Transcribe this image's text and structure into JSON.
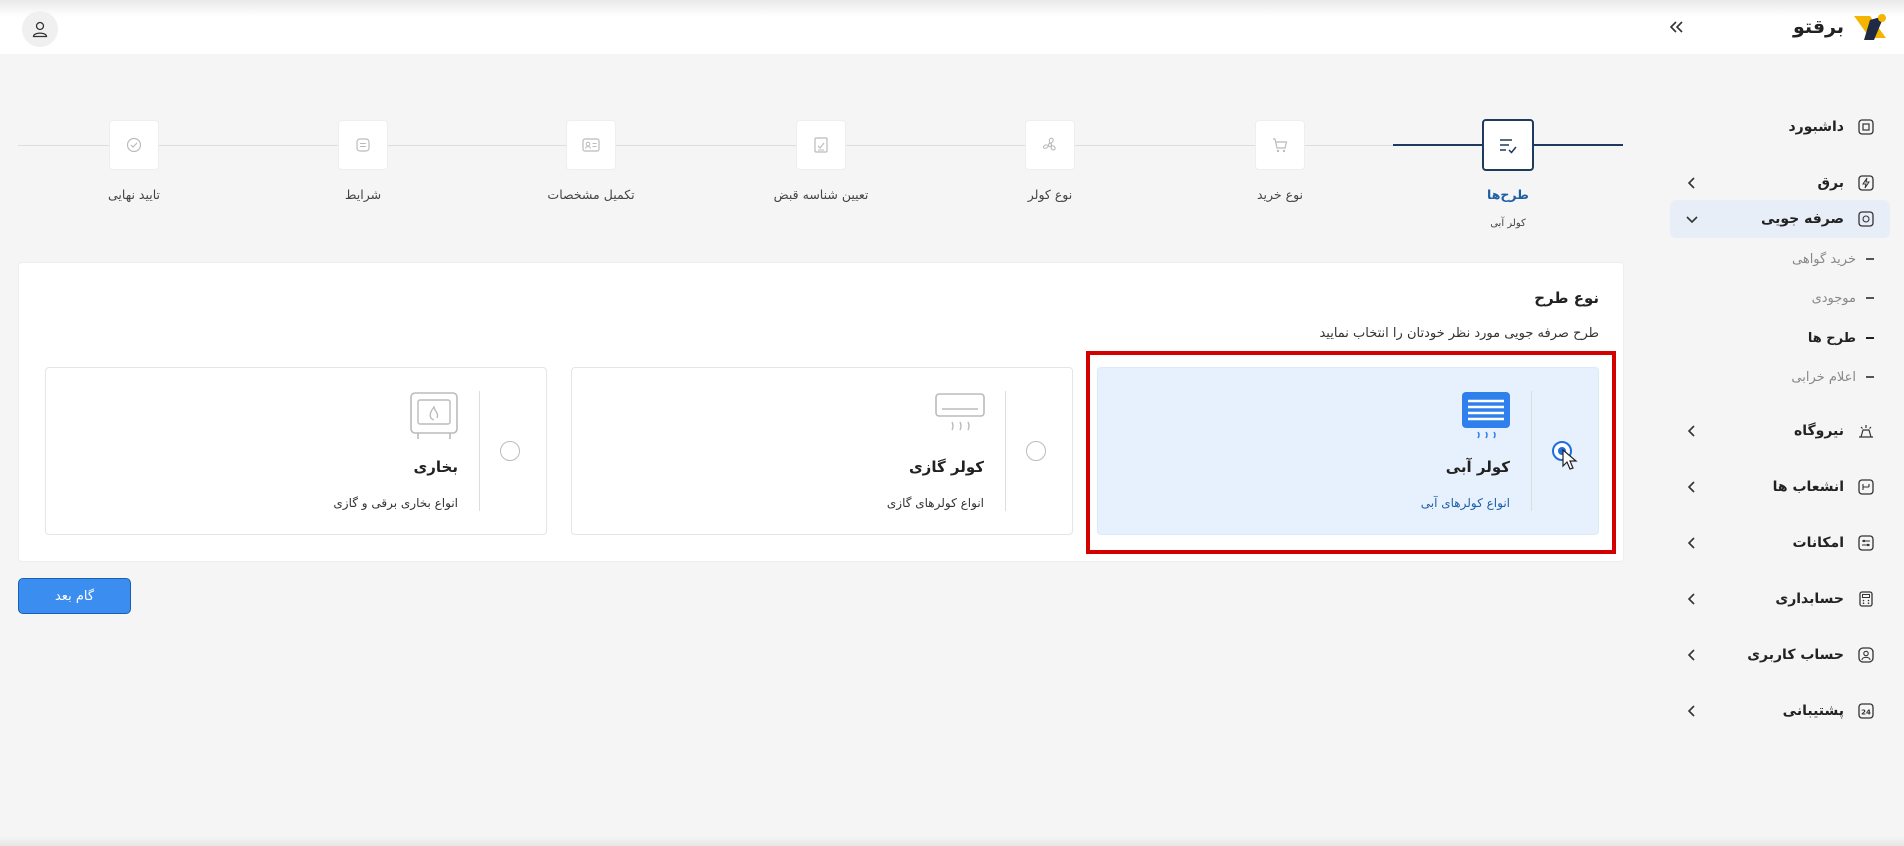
{
  "app": {
    "logo_text": "برقتو"
  },
  "sidebar": {
    "items": [
      {
        "label": "داشبورد",
        "icon": "dashboard-icon",
        "has_chevron": false
      },
      {
        "label": "برق",
        "icon": "electricity-icon",
        "has_chevron": true
      },
      {
        "label": "صرفه جویی",
        "icon": "saving-icon",
        "has_chevron": true,
        "expanded": true
      },
      {
        "label": "نیروگاه",
        "icon": "power-plant-icon",
        "has_chevron": true
      },
      {
        "label": "انشعاب ها",
        "icon": "branch-icon",
        "has_chevron": true
      },
      {
        "label": "امکانات",
        "icon": "features-icon",
        "has_chevron": true
      },
      {
        "label": "حسابداری",
        "icon": "calculator-icon",
        "has_chevron": true
      },
      {
        "label": "حساب کاربری",
        "icon": "user-icon",
        "has_chevron": true
      },
      {
        "label": "پشتیبانی",
        "icon": "support-24-icon",
        "has_chevron": true
      }
    ],
    "sub_items": [
      {
        "label": "خرید گواهی",
        "current": false
      },
      {
        "label": "موجودی",
        "current": false
      },
      {
        "label": "طرح ها",
        "current": true
      },
      {
        "label": "اعلام خرابی",
        "current": false
      }
    ]
  },
  "stepper": {
    "steps": [
      {
        "label": "طرح‌ها",
        "sub": "کولر آبی",
        "icon": "list-check-icon",
        "active": true
      },
      {
        "label": "نوع خرید",
        "icon": "cart-icon",
        "active": false
      },
      {
        "label": "نوع کولر",
        "icon": "fan-icon",
        "active": false
      },
      {
        "label": "تعیین شناسه قبض",
        "icon": "bill-icon",
        "active": false
      },
      {
        "label": "تکمیل مشخصات",
        "icon": "id-card-icon",
        "active": false
      },
      {
        "label": "شرایط",
        "icon": "terms-icon",
        "active": false
      },
      {
        "label": "تایید نهایی",
        "icon": "check-circle-icon",
        "active": false
      }
    ]
  },
  "plan": {
    "title": "نوع طرح",
    "description": "طرح صرفه جویی مورد نظر خودتان را انتخاب نمایید",
    "options": [
      {
        "title": "کولر آبی",
        "desc": "انواع کولرهای آبی",
        "icon": "water-cooler-icon",
        "selected": true
      },
      {
        "title": "کولر گازی",
        "desc": "انواع کولرهای گازی",
        "icon": "air-conditioner-icon",
        "selected": false
      },
      {
        "title": "بخاری",
        "desc": "انواع بخاری برقی و گازی",
        "icon": "heater-icon",
        "selected": false
      }
    ]
  },
  "actions": {
    "next_label": "گام بعد"
  },
  "colors": {
    "accent": "#1e3a5f",
    "primary_button": "#3b8ef0",
    "highlight_box": "#d40000",
    "selected_bg": "#e6f1fd"
  }
}
